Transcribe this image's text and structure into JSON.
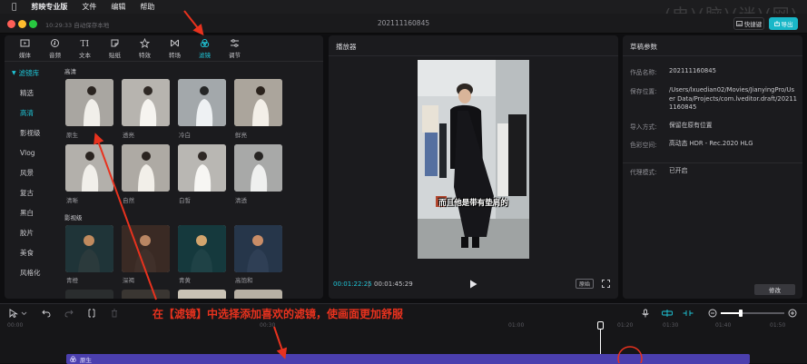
{
  "menubar": {
    "apple": "",
    "app_name": "剪映专业版",
    "items": [
      "文件",
      "编辑",
      "帮助"
    ]
  },
  "watermark": "(电)(脑)(迷)(网)",
  "titlebar": {
    "autosave": "10:29:33 自动保存本地",
    "project_title": "202111160845",
    "shortcut_label": "快捷键",
    "export_label": "导出"
  },
  "toolbar": {
    "tabs": [
      {
        "label": "媒体",
        "icon": "media-icon"
      },
      {
        "label": "音频",
        "icon": "audio-icon"
      },
      {
        "label": "文本",
        "icon": "text-icon"
      },
      {
        "label": "贴纸",
        "icon": "sticker-icon"
      },
      {
        "label": "特效",
        "icon": "effects-icon"
      },
      {
        "label": "转场",
        "icon": "transition-icon"
      },
      {
        "label": "滤镜",
        "icon": "filter-icon",
        "active": true
      },
      {
        "label": "调节",
        "icon": "adjust-icon"
      }
    ]
  },
  "sidebar": {
    "header": "滤镜库",
    "items": [
      "精选",
      "高清",
      "影视级",
      "Vlog",
      "风景",
      "复古",
      "黑白",
      "胶片",
      "美食",
      "风格化"
    ],
    "active_index": 1
  },
  "filters": {
    "section_hd": "高清",
    "hd_items": [
      "原生",
      "透亮",
      "冷白",
      "鲜亮",
      "清晰",
      "自然",
      "白皙",
      "清透"
    ],
    "section_cinema": "影视级",
    "cinema_items": [
      "青橙",
      "深褐",
      "青黄",
      "高饱和"
    ]
  },
  "player": {
    "title": "播放器",
    "subtitle": "而且他是带有垫肩的",
    "time_current": "00:01:22:25",
    "time_sep": "|",
    "time_total": "00:01:45:29",
    "ratio_label": "原始"
  },
  "params": {
    "title": "草稿参数",
    "rows": [
      {
        "key": "作品名称:",
        "value": "202111160845"
      },
      {
        "key": "保存位置:",
        "value": "/Users/lxuedian02/Movies/JianyingPro/User Data/Projects/com.lveditor.draft/202111160845"
      },
      {
        "key": "导入方式:",
        "value": "保留在原有位置"
      },
      {
        "key": "色彩空间:",
        "value": "高动态 HDR - Rec.2020 HLG"
      },
      {
        "key": "代理模式:",
        "value": "已开启"
      }
    ],
    "edit_label": "修改"
  },
  "timeline": {
    "ticks": [
      "00:00",
      "00:30",
      "01:00",
      "01:20",
      "01:30",
      "01:40",
      "01:50"
    ],
    "filter_track_label": "原生",
    "zoom_level": 0.3
  },
  "annotation": {
    "caption": "在【滤镜】中选择添加喜欢的滤镜，使画面更加舒服",
    "color": "#e8321e"
  },
  "colors": {
    "accent": "#1fc6d8",
    "filter_track": "#4b3fae",
    "annotation_red": "#e8321e"
  }
}
